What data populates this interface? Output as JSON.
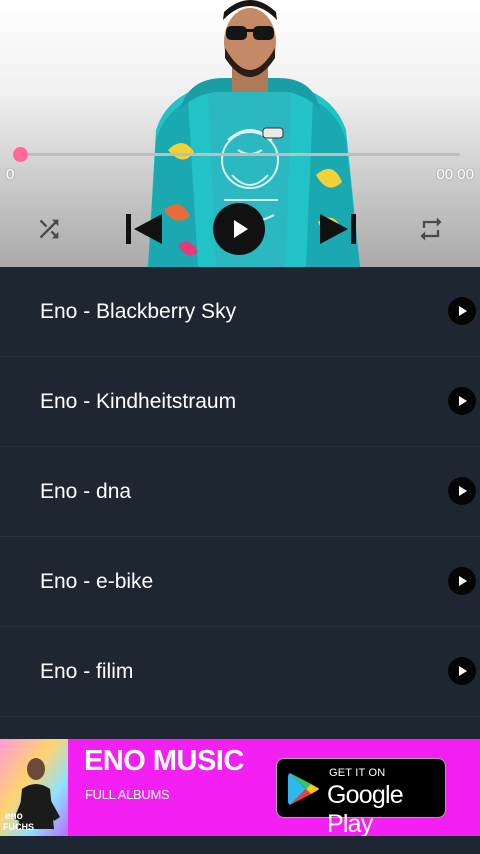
{
  "player": {
    "time_current": "0",
    "time_total": "00 00",
    "progress": 0,
    "accent_color": "#ff6a96",
    "controls": {
      "shuffle_icon": "shuffle-icon",
      "prev_icon": "skip-previous-icon",
      "play_icon": "play-icon",
      "next_icon": "skip-next-icon",
      "repeat_icon": "repeat-icon"
    }
  },
  "songs": [
    {
      "title": "Eno - Blackberry Sky"
    },
    {
      "title": "Eno - Kindheitstraum"
    },
    {
      "title": "Eno - dna"
    },
    {
      "title": "Eno - e-bike"
    },
    {
      "title": "Eno - filim"
    }
  ],
  "ad": {
    "title": "ENO MUSIC",
    "subtitle": "FULL ALBUMS",
    "store_small": "GET IT ON",
    "store_big": "Google Play",
    "background_color": "#f31ff3"
  },
  "colors": {
    "list_background": "#1e2631",
    "row_play_button": "#050505"
  }
}
